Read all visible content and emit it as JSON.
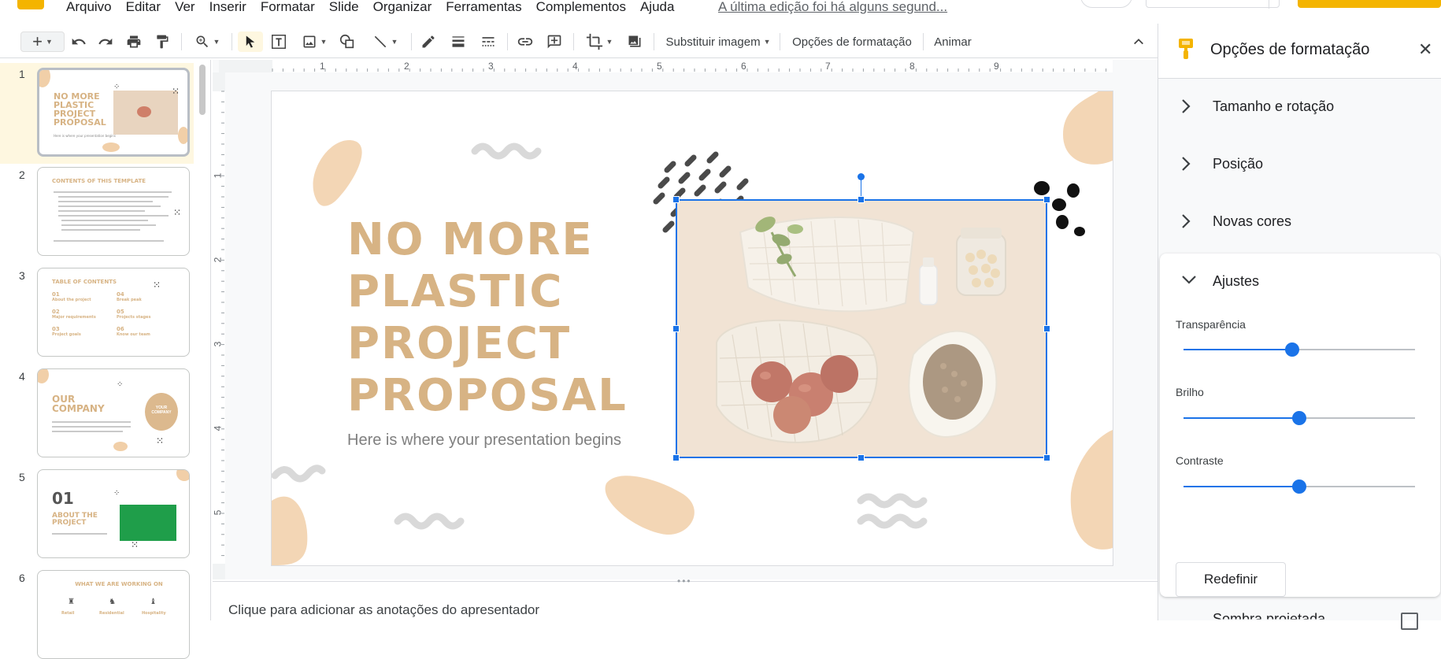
{
  "menu": {
    "items": [
      "Arquivo",
      "Editar",
      "Ver",
      "Inserir",
      "Formatar",
      "Slide",
      "Organizar",
      "Ferramentas",
      "Complementos",
      "Ajuda"
    ],
    "last_edit": "A última edição foi há alguns segund..."
  },
  "toolbar": {
    "replace_image": "Substituir imagem",
    "format_options": "Opções de formatação",
    "animate": "Animar"
  },
  "ruler": {
    "h": [
      "1",
      "2",
      "3",
      "4",
      "5",
      "6",
      "7",
      "8",
      "9"
    ],
    "v": [
      "1",
      "2",
      "3",
      "4",
      "5"
    ]
  },
  "filmstrip": {
    "slides": [
      {
        "num": "1",
        "title": "NO MORE PLASTIC PROJECT PROPOSAL",
        "sub": "Here is where your presentation begins"
      },
      {
        "num": "2",
        "title": "CONTENTS OF THIS TEMPLATE"
      },
      {
        "num": "3",
        "title": "TABLE OF CONTENTS",
        "items": [
          "01",
          "About the project",
          "02",
          "Major requirements",
          "03",
          "Project goals",
          "04",
          "Break peak",
          "05",
          "Projects stages",
          "06",
          "Know our team"
        ]
      },
      {
        "num": "4",
        "title": "OUR COMPANY",
        "badge": "YOUR COMPANY"
      },
      {
        "num": "5",
        "big": "01",
        "title": "ABOUT THE PROJECT"
      },
      {
        "num": "6",
        "title": "WHAT WE ARE WORKING ON",
        "items": [
          "Retail",
          "Residential",
          "Hospitality"
        ]
      }
    ]
  },
  "slide": {
    "title_lines": [
      "NO MORE",
      "PLASTIC",
      "PROJECT",
      "PROPOSAL"
    ],
    "subtitle": "Here is where your presentation begins"
  },
  "notes": {
    "placeholder": "Clique para adicionar as anotações do apresentador"
  },
  "panel": {
    "title": "Opções de formatação",
    "sections": [
      "Tamanho e rotação",
      "Posição",
      "Novas cores",
      "Ajustes"
    ],
    "sliders": [
      {
        "label": "Transparência",
        "value": 0.47
      },
      {
        "label": "Brilho",
        "value": 0.5
      },
      {
        "label": "Contraste",
        "value": 0.5
      }
    ],
    "reset": "Redefinir",
    "last_section": "Sombra projetada"
  },
  "colors": {
    "accent": "#1a73e8",
    "title": "#d7b384",
    "blob": "#f1cfa8",
    "brand": "#f4b400"
  }
}
